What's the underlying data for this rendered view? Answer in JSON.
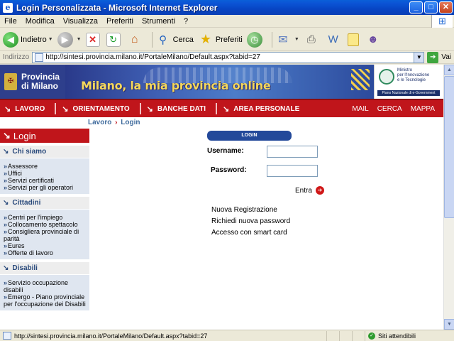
{
  "window": {
    "title": "Login Personalizzata - Microsoft Internet Explorer",
    "app_icon": "ie-icon",
    "controls": [
      "_",
      "□",
      "✕"
    ]
  },
  "menu": [
    "File",
    "Modifica",
    "Visualizza",
    "Preferiti",
    "Strumenti",
    "?"
  ],
  "toolbar": {
    "back_label": "Indietro",
    "search_label": "Cerca",
    "favorites_label": "Preferiti"
  },
  "address": {
    "label": "Indirizzo",
    "url": "http://sintesi.provincia.milano.it/PortaleMilano/Default.aspx?tabid=27",
    "go_label": "Vai"
  },
  "site": {
    "brand_line1": "Provincia",
    "brand_line2": "di Milano",
    "tagline": "Milano, la mia provincia online",
    "ministry_line1": "Ministro",
    "ministry_line2": "per l'Innovazione",
    "ministry_line3": "e le Tecnologie",
    "ministry_bar": "Piano Nazionale di e-Government"
  },
  "nav": {
    "items": [
      "LAVORO",
      "ORIENTAMENTO",
      "BANCHE DATI",
      "AREA PERSONALE"
    ],
    "links": [
      "MAIL",
      "CERCA",
      "MAPPA"
    ]
  },
  "breadcrumb": {
    "part1": "Lavoro",
    "sep": "›",
    "part2": "Login"
  },
  "sidebar": {
    "title": "Login",
    "sections": [
      {
        "title": "Chi siamo",
        "items": [
          "Assessore",
          "Uffici",
          "Servizi certificati",
          "Servizi per gli operatori"
        ]
      },
      {
        "title": "Cittadini",
        "items": [
          "Centri per l'impiego",
          "Collocamento spettacolo",
          "Consigliera provinciale di parità",
          "Eures",
          "Offerte di lavoro"
        ]
      },
      {
        "title": "Disabili",
        "items": [
          "Servizio occupazione disabili",
          "Emergo - Piano provinciale per l'occupazione dei Disabili"
        ]
      }
    ]
  },
  "login": {
    "header": "LOGIN",
    "username_label": "Username:",
    "password_label": "Password:",
    "username_value": "",
    "password_value": "",
    "submit_label": "Entra",
    "links": [
      "Nuova Registrazione",
      "Richiedi nuova password",
      "Accesso con smart card"
    ]
  },
  "status": {
    "text": "http://sintesi.provincia.milano.it/PortaleMilano/Default.aspx?tabid=27",
    "zone": "Siti attendibili"
  },
  "colors": {
    "titlebar": "#0a4fd0",
    "nav_red": "#c0151b",
    "brand_blue": "#2e3f8c",
    "login_blue": "#23499a",
    "sidebar_link": "#2b4b7c"
  }
}
